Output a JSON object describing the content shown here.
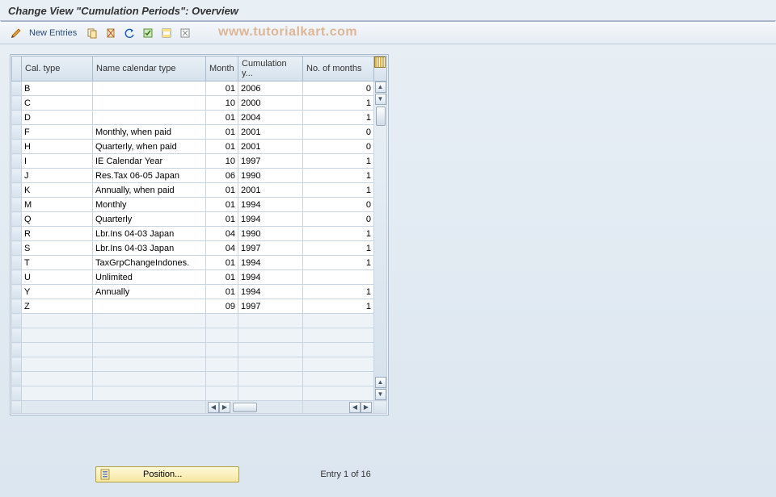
{
  "title": "Change View \"Cumulation Periods\": Overview",
  "watermark": "www.tutorialkart.com",
  "toolbar": {
    "newEntries": "New Entries"
  },
  "columns": {
    "calType": "Cal. type",
    "name": "Name calendar type",
    "month": "Month",
    "cumu": "Cumulation y...",
    "nom": "No. of months"
  },
  "rows": [
    {
      "ct": "B",
      "name": "",
      "month": "01",
      "cumu": "2006",
      "nom": "0"
    },
    {
      "ct": "C",
      "name": "",
      "month": "10",
      "cumu": "2000",
      "nom": "1"
    },
    {
      "ct": "D",
      "name": "",
      "month": "01",
      "cumu": "2004",
      "nom": "1"
    },
    {
      "ct": "F",
      "name": "Monthly, when paid",
      "month": "01",
      "cumu": "2001",
      "nom": "0"
    },
    {
      "ct": "H",
      "name": "Quarterly, when paid",
      "month": "01",
      "cumu": "2001",
      "nom": "0"
    },
    {
      "ct": "I",
      "name": "IE Calendar Year",
      "month": "10",
      "cumu": "1997",
      "nom": "1"
    },
    {
      "ct": "J",
      "name": "Res.Tax 06-05  Japan",
      "month": "06",
      "cumu": "1990",
      "nom": "1"
    },
    {
      "ct": "K",
      "name": "Annually, when paid",
      "month": "01",
      "cumu": "2001",
      "nom": "1"
    },
    {
      "ct": "M",
      "name": "Monthly",
      "month": "01",
      "cumu": "1994",
      "nom": "0"
    },
    {
      "ct": "Q",
      "name": "Quarterly",
      "month": "01",
      "cumu": "1994",
      "nom": "0"
    },
    {
      "ct": "R",
      "name": "Lbr.Ins 04-03  Japan",
      "month": "04",
      "cumu": "1990",
      "nom": "1"
    },
    {
      "ct": "S",
      "name": "Lbr.Ins 04-03  Japan",
      "month": "04",
      "cumu": "1997",
      "nom": "1"
    },
    {
      "ct": "T",
      "name": "TaxGrpChangeIndones.",
      "month": "01",
      "cumu": "1994",
      "nom": "1"
    },
    {
      "ct": "U",
      "name": "Unlimited",
      "month": "01",
      "cumu": "1994",
      "nom": ""
    },
    {
      "ct": "Y",
      "name": "Annually",
      "month": "01",
      "cumu": "1994",
      "nom": "1"
    },
    {
      "ct": "Z",
      "name": "",
      "month": "09",
      "cumu": "1997",
      "nom": "1"
    }
  ],
  "blankRows": 6,
  "footer": {
    "position": "Position...",
    "entry": "Entry 1 of 16"
  }
}
